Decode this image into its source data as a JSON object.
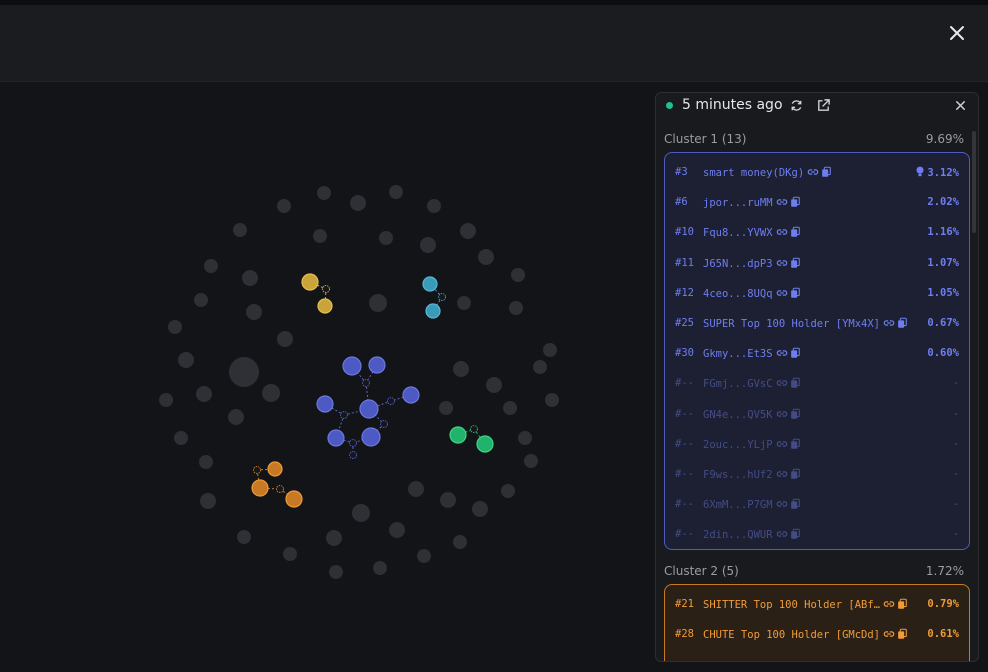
{
  "panel": {
    "updated": "5 minutes ago"
  },
  "clusters": [
    {
      "label": "Cluster 1 (13)",
      "percent": "9.69%",
      "rows": [
        {
          "rank": "#3",
          "name": "smart money(DKg)",
          "percent": "3.12%",
          "bulb": true,
          "dim": false
        },
        {
          "rank": "#6",
          "name": "jpor...ruMM",
          "percent": "2.02%",
          "dim": false
        },
        {
          "rank": "#10",
          "name": "Fqu8...YVWX",
          "percent": "1.16%",
          "dim": false
        },
        {
          "rank": "#11",
          "name": "J65N...dpP3",
          "percent": "1.07%",
          "dim": false
        },
        {
          "rank": "#12",
          "name": "4ceo...8UQq",
          "percent": "1.05%",
          "dim": false
        },
        {
          "rank": "#25",
          "name": "SUPER Top 100 Holder [YMx4X]",
          "percent": "0.67%",
          "dim": false
        },
        {
          "rank": "#30",
          "name": "Gkmy...Et3S",
          "percent": "0.60%",
          "dim": false
        },
        {
          "rank": "#--",
          "name": "FGmj...GVsC",
          "percent": "-",
          "dim": true
        },
        {
          "rank": "#--",
          "name": "GN4e...QV5K",
          "percent": "-",
          "dim": true
        },
        {
          "rank": "#--",
          "name": "2ouc...YLjP",
          "percent": "-",
          "dim": true
        },
        {
          "rank": "#--",
          "name": "F9ws...hUf2",
          "percent": "-",
          "dim": true
        },
        {
          "rank": "#--",
          "name": "6XmM...P7GM",
          "percent": "-",
          "dim": true
        },
        {
          "rank": "#--",
          "name": "2din...QWUR",
          "percent": "-",
          "dim": true
        }
      ]
    },
    {
      "label": "Cluster 2 (5)",
      "percent": "1.72%",
      "rows": [
        {
          "rank": "#21",
          "name": "SHITTER Top 100 Holder [ABf…",
          "percent": "0.79%",
          "dim": false
        },
        {
          "rank": "#28",
          "name": "CHUTE Top 100 Holder [GMcDd]",
          "percent": "0.61%",
          "dim": false
        }
      ]
    }
  ],
  "colors": {
    "cluster1": "#4d5ac4",
    "cluster2": "#c77a23",
    "yellow": "#c9a43a",
    "teal": "#3a9bb8",
    "green": "#22b36b",
    "grey": "#2e3035"
  },
  "icons": {
    "close": "close-icon",
    "refresh": "refresh-icon",
    "external": "external-link-icon",
    "link": "link-icon",
    "copy": "copy-icon",
    "bulb": "lightbulb-icon"
  }
}
